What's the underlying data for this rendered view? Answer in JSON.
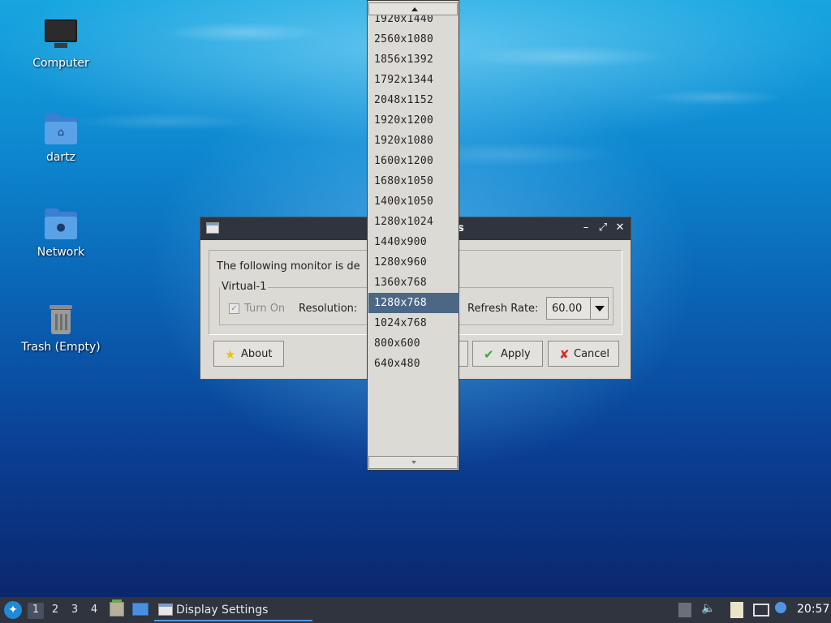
{
  "desktop": {
    "icons": [
      {
        "label": "Computer",
        "icon": "computer-icon"
      },
      {
        "label": "dartz",
        "icon": "home-folder-icon"
      },
      {
        "label": "Network",
        "icon": "network-folder-icon"
      },
      {
        "label": "Trash (Empty)",
        "icon": "trash-icon"
      }
    ]
  },
  "dialog": {
    "title": "Display Settings",
    "message": "The following monitor is de",
    "monitor_name": "Virtual-1",
    "turn_on_label": "Turn On",
    "turn_on_checked": true,
    "resolution_label": "Resolution:",
    "refresh_rate_label": "Refresh Rate:",
    "refresh_rate_value": "60.00",
    "buttons": {
      "about": "About",
      "apply": "Apply",
      "cancel": "Cancel"
    },
    "window_controls": {
      "minimize": "–",
      "maximize": "⤢",
      "close": "✕"
    }
  },
  "resolution_dropdown": {
    "selected": "1280x768",
    "options": [
      "1920x1440",
      "2560x1080",
      "1856x1392",
      "1792x1344",
      "2048x1152",
      "1920x1200",
      "1920x1080",
      "1600x1200",
      "1680x1050",
      "1400x1050",
      "1280x1024",
      "1440x900",
      "1280x960",
      "1360x768",
      "1280x768",
      "1024x768",
      "800x600",
      "640x480"
    ]
  },
  "taskbar": {
    "workspaces": [
      "1",
      "2",
      "3",
      "4"
    ],
    "active_workspace": "1",
    "task_label": "Display Settings",
    "clock": "20:57"
  },
  "colors": {
    "selection": "#4b6784",
    "titlebar": "#2f343f",
    "dialog_bg": "#dcdad5",
    "taskbar": "#2f343f"
  }
}
